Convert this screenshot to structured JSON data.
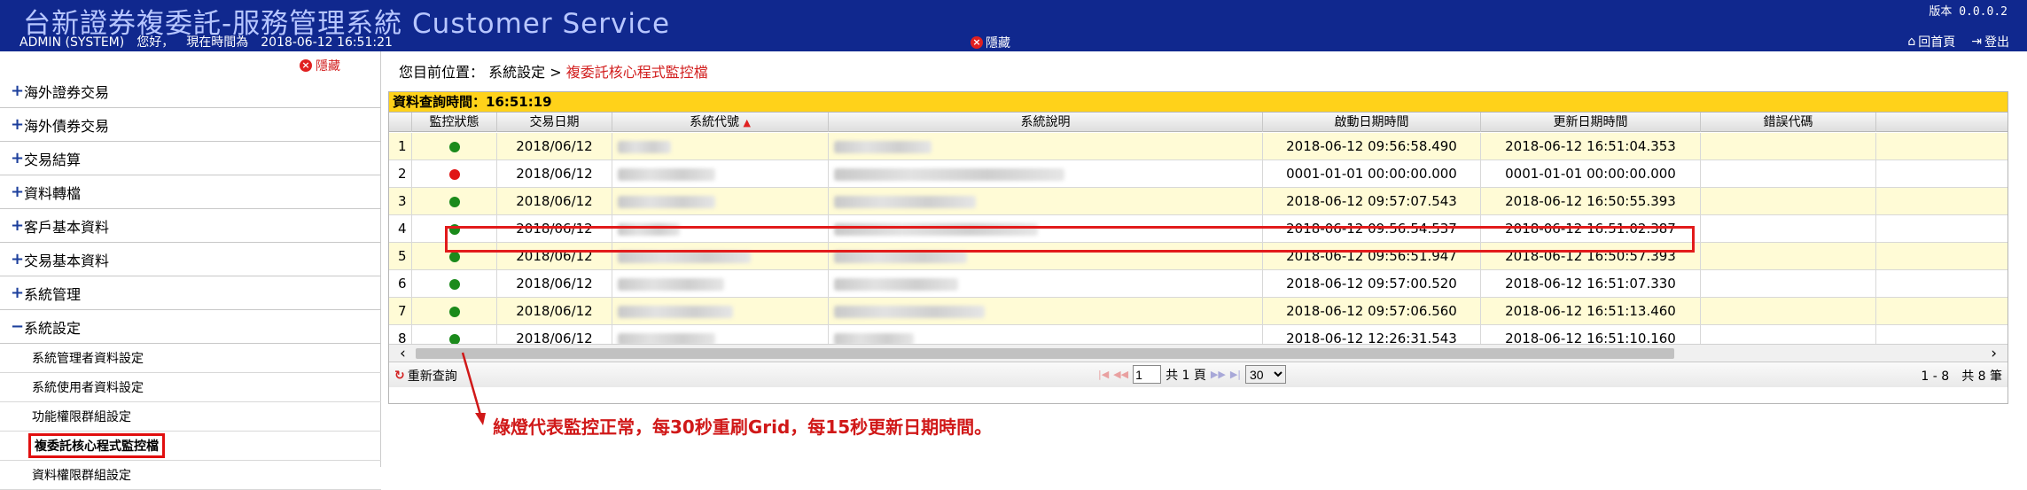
{
  "header": {
    "title": "台新證券複委託-服務管理系統 Customer Service",
    "user": "ADMIN (SYSTEM)",
    "greeting": "您好，",
    "time_label": "現在時間為",
    "time": "2018-06-12 16:51:21",
    "version": "版本 0.0.0.2",
    "hide": "隱藏",
    "home": "回首頁",
    "logout": "登出"
  },
  "sidebar": {
    "hide": "隱藏",
    "menus": [
      {
        "pm": "+",
        "label": "海外證券交易"
      },
      {
        "pm": "+",
        "label": "海外債券交易"
      },
      {
        "pm": "+",
        "label": "交易結算"
      },
      {
        "pm": "+",
        "label": "資料轉檔"
      },
      {
        "pm": "+",
        "label": "客戶基本資料"
      },
      {
        "pm": "+",
        "label": "交易基本資料"
      },
      {
        "pm": "+",
        "label": "系統管理"
      },
      {
        "pm": "−",
        "label": "系統設定"
      }
    ],
    "subs": [
      {
        "label": "系統管理者資料設定"
      },
      {
        "label": "系統使用者資料設定"
      },
      {
        "label": "功能權限群組設定"
      },
      {
        "label": "複委託核心程式監控檔"
      },
      {
        "label": "資料權限群組設定"
      }
    ]
  },
  "breadcrumb": {
    "prefix": "您目前位置：",
    "parent": "系統設定 >",
    "current": "複委託核心程式監控檔"
  },
  "grid": {
    "query_time": "資料查詢時間：16:51:19",
    "headers": [
      "監控狀態",
      "交易日期",
      "系統代號",
      "系統說明",
      "啟動日期時間",
      "更新日期時間",
      "錯誤代碼"
    ],
    "colors": {
      "green": "#1b8a1b",
      "red": "#e01515"
    },
    "rows": [
      {
        "n": "1",
        "status": "green",
        "date": "2018/06/12",
        "start": "2018-06-12 09:56:58.490",
        "update": "2018-06-12 16:51:04.353"
      },
      {
        "n": "2",
        "status": "red",
        "date": "2018/06/12",
        "start": "0001-01-01 00:00:00.000",
        "update": "0001-01-01 00:00:00.000"
      },
      {
        "n": "3",
        "status": "green",
        "date": "2018/06/12",
        "start": "2018-06-12 09:57:07.543",
        "update": "2018-06-12 16:50:55.393"
      },
      {
        "n": "4",
        "status": "green",
        "date": "2018/06/12",
        "start": "2018-06-12 09:56:54.537",
        "update": "2018-06-12 16:51:02.387"
      },
      {
        "n": "5",
        "status": "green",
        "date": "2018/06/12",
        "start": "2018-06-12 09:56:51.947",
        "update": "2018-06-12 16:50:57.393"
      },
      {
        "n": "6",
        "status": "green",
        "date": "2018/06/12",
        "start": "2018-06-12 09:57:00.520",
        "update": "2018-06-12 16:51:07.330"
      },
      {
        "n": "7",
        "status": "green",
        "date": "2018/06/12",
        "start": "2018-06-12 09:57:06.560",
        "update": "2018-06-12 16:51:13.460"
      },
      {
        "n": "8",
        "status": "green",
        "date": "2018/06/12",
        "start": "2018-06-12 12:26:31.543",
        "update": "2018-06-12 16:51:10.160"
      }
    ]
  },
  "pager": {
    "refresh": "重新查詢",
    "page": "1",
    "total_pages": "共 1 頁",
    "page_size": "30",
    "range": "1 - 8　共 8 筆"
  },
  "note": "綠燈代表監控正常，每30秒重刷Grid，每15秒更新日期時間。"
}
